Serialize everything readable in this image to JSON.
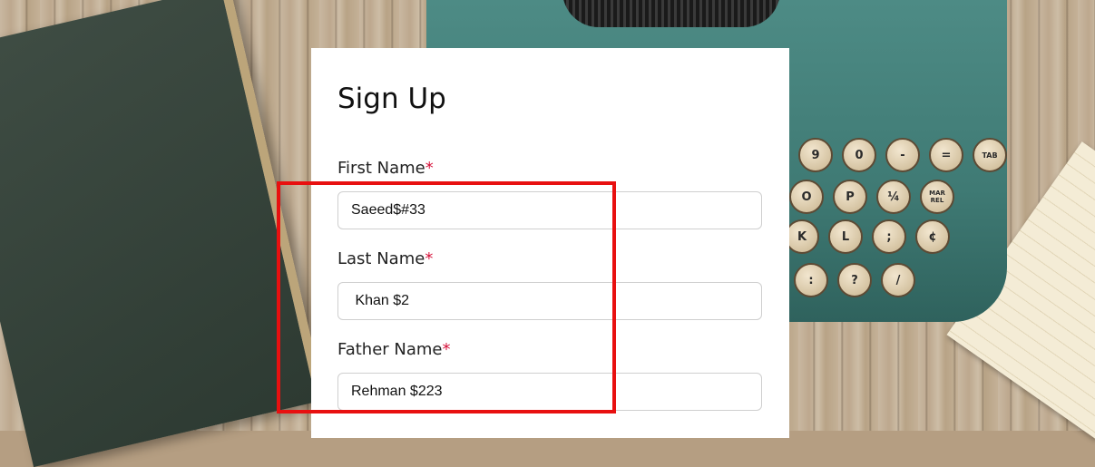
{
  "form": {
    "title": "Sign Up",
    "required_marker": "*",
    "fields": [
      {
        "label": "First Name",
        "value": "Saeed$#33"
      },
      {
        "label": "Last Name",
        "value": " Khan $2"
      },
      {
        "label": "Father Name",
        "value": "Rehman $223"
      }
    ]
  },
  "background": {
    "keys_row1": [
      "9",
      "0",
      "-",
      "=",
      "TAB"
    ],
    "keys_row2": [
      "O",
      "P",
      "¼",
      "MAR REL"
    ],
    "keys_row3": [
      "K",
      "L",
      ";",
      "¢"
    ],
    "keys_row4": [
      ":",
      "?",
      "/"
    ]
  },
  "colors": {
    "accent_required": "#d6123a",
    "highlight_box": "#e81010",
    "card_background": "#ffffff"
  }
}
